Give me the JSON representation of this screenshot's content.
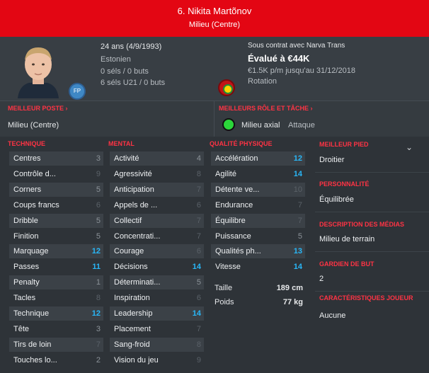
{
  "header": {
    "name": "6. Nikita Martõnov",
    "position": "Milieu (Centre)"
  },
  "info": {
    "age": "24 ans (4/9/1993)",
    "nation": "Estonien",
    "nation_code": "FP",
    "caps": "0 séls / 0 buts",
    "u21": "6 séls U21 / 0 buts",
    "contract": "Sous contrat avec Narva Trans",
    "value": "Évalué à €44K",
    "wage": "€1.5K p/m jusqu'au 31/12/2018",
    "status": "Rotation"
  },
  "best_position": {
    "heading": "MEILLEUR POSTE",
    "value": "Milieu (Centre)"
  },
  "best_role": {
    "heading": "MEILLEURS RÔLE ET TÂCHE",
    "role": "Milieu axial",
    "duty": "Attaque"
  },
  "technique": {
    "heading": "TECHNIQUE",
    "rows": [
      {
        "label": "Centres",
        "value": "3"
      },
      {
        "label": "Contrôle d...",
        "value": "9"
      },
      {
        "label": "Corners",
        "value": "5"
      },
      {
        "label": "Coups francs",
        "value": "6"
      },
      {
        "label": "Dribble",
        "value": "5"
      },
      {
        "label": "Finition",
        "value": "5"
      },
      {
        "label": "Marquage",
        "value": "12"
      },
      {
        "label": "Passes",
        "value": "11"
      },
      {
        "label": "Penalty",
        "value": "1"
      },
      {
        "label": "Tacles",
        "value": "8"
      },
      {
        "label": "Technique",
        "value": "12"
      },
      {
        "label": "Tête",
        "value": "3"
      },
      {
        "label": "Tirs de loin",
        "value": "7"
      },
      {
        "label": "Touches lo...",
        "value": "2"
      }
    ]
  },
  "mental": {
    "heading": "MENTAL",
    "rows": [
      {
        "label": "Activité",
        "value": "4"
      },
      {
        "label": "Agressivité",
        "value": "8"
      },
      {
        "label": "Anticipation",
        "value": "7"
      },
      {
        "label": "Appels de ...",
        "value": "6"
      },
      {
        "label": "Collectif",
        "value": "7"
      },
      {
        "label": "Concentrati...",
        "value": "7"
      },
      {
        "label": "Courage",
        "value": "6"
      },
      {
        "label": "Décisions",
        "value": "14"
      },
      {
        "label": "Déterminati...",
        "value": "5"
      },
      {
        "label": "Inspiration",
        "value": "6"
      },
      {
        "label": "Leadership",
        "value": "14"
      },
      {
        "label": "Placement",
        "value": "7"
      },
      {
        "label": "Sang-froid",
        "value": "8"
      },
      {
        "label": "Vision du jeu",
        "value": "9"
      }
    ]
  },
  "physical": {
    "heading": "QUALITÉ PHYSIQUE",
    "rows": [
      {
        "label": "Accélération",
        "value": "12"
      },
      {
        "label": "Agilité",
        "value": "14"
      },
      {
        "label": "Détente ve...",
        "value": "10"
      },
      {
        "label": "Endurance",
        "value": "7"
      },
      {
        "label": "Équilibre",
        "value": "7"
      },
      {
        "label": "Puissance",
        "value": "5"
      },
      {
        "label": "Qualités ph...",
        "value": "13"
      },
      {
        "label": "Vitesse",
        "value": "14"
      }
    ],
    "height_label": "Taille",
    "height_value": "189 cm",
    "weight_label": "Poids",
    "weight_value": "77 kg"
  },
  "side": {
    "best_foot_h": "MEILLEUR PIED",
    "best_foot": "Droitier",
    "personality_h": "PERSONNALITÉ",
    "personality": "Équilibrée",
    "media_h": "DESCRIPTION DES MÉDIAS",
    "media": "Milieu de terrain",
    "gk_h": "GARDIEN DE BUT",
    "gk": "2",
    "traits_h": "CARACTÉRISTIQUES JOUEUR",
    "traits": "Aucune"
  }
}
